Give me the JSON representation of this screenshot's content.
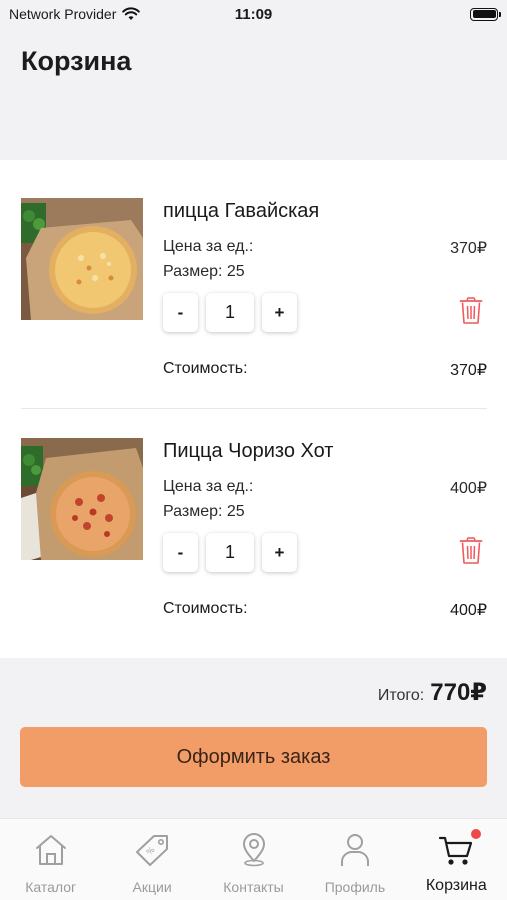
{
  "status_bar": {
    "carrier": "Network Provider",
    "time": "11:09"
  },
  "page": {
    "title": "Корзина"
  },
  "cart": {
    "price_label": "Цена за ед.:",
    "cost_label": "Стоимость:",
    "items": [
      {
        "name": "пицца Гавайская",
        "price": "370₽",
        "size": "Размер: 25",
        "quantity": "1",
        "cost": "370₽",
        "minus": "-",
        "plus": "+"
      },
      {
        "name": "Пицца Чоризо Хот",
        "price": "400₽",
        "size": "Размер: 25",
        "quantity": "1",
        "cost": "400₽",
        "minus": "-",
        "plus": "+"
      }
    ]
  },
  "summary": {
    "total_label": "Итого:",
    "total_value": "770₽"
  },
  "order_button": {
    "label": "Оформить заказ"
  },
  "tabbar": {
    "tabs": [
      {
        "label": "Каталог",
        "icon": "home-icon",
        "active": false
      },
      {
        "label": "Акции",
        "icon": "tag-icon",
        "active": false
      },
      {
        "label": "Контакты",
        "icon": "location-pin-icon",
        "active": false
      },
      {
        "label": "Профиль",
        "icon": "user-icon",
        "active": false
      },
      {
        "label": "Корзина",
        "icon": "cart-icon",
        "active": true
      }
    ]
  },
  "colors": {
    "accent": "#f29d68",
    "delete": "#ef5a5a",
    "badge": "#ef4848",
    "background": "#f2f2f5"
  }
}
